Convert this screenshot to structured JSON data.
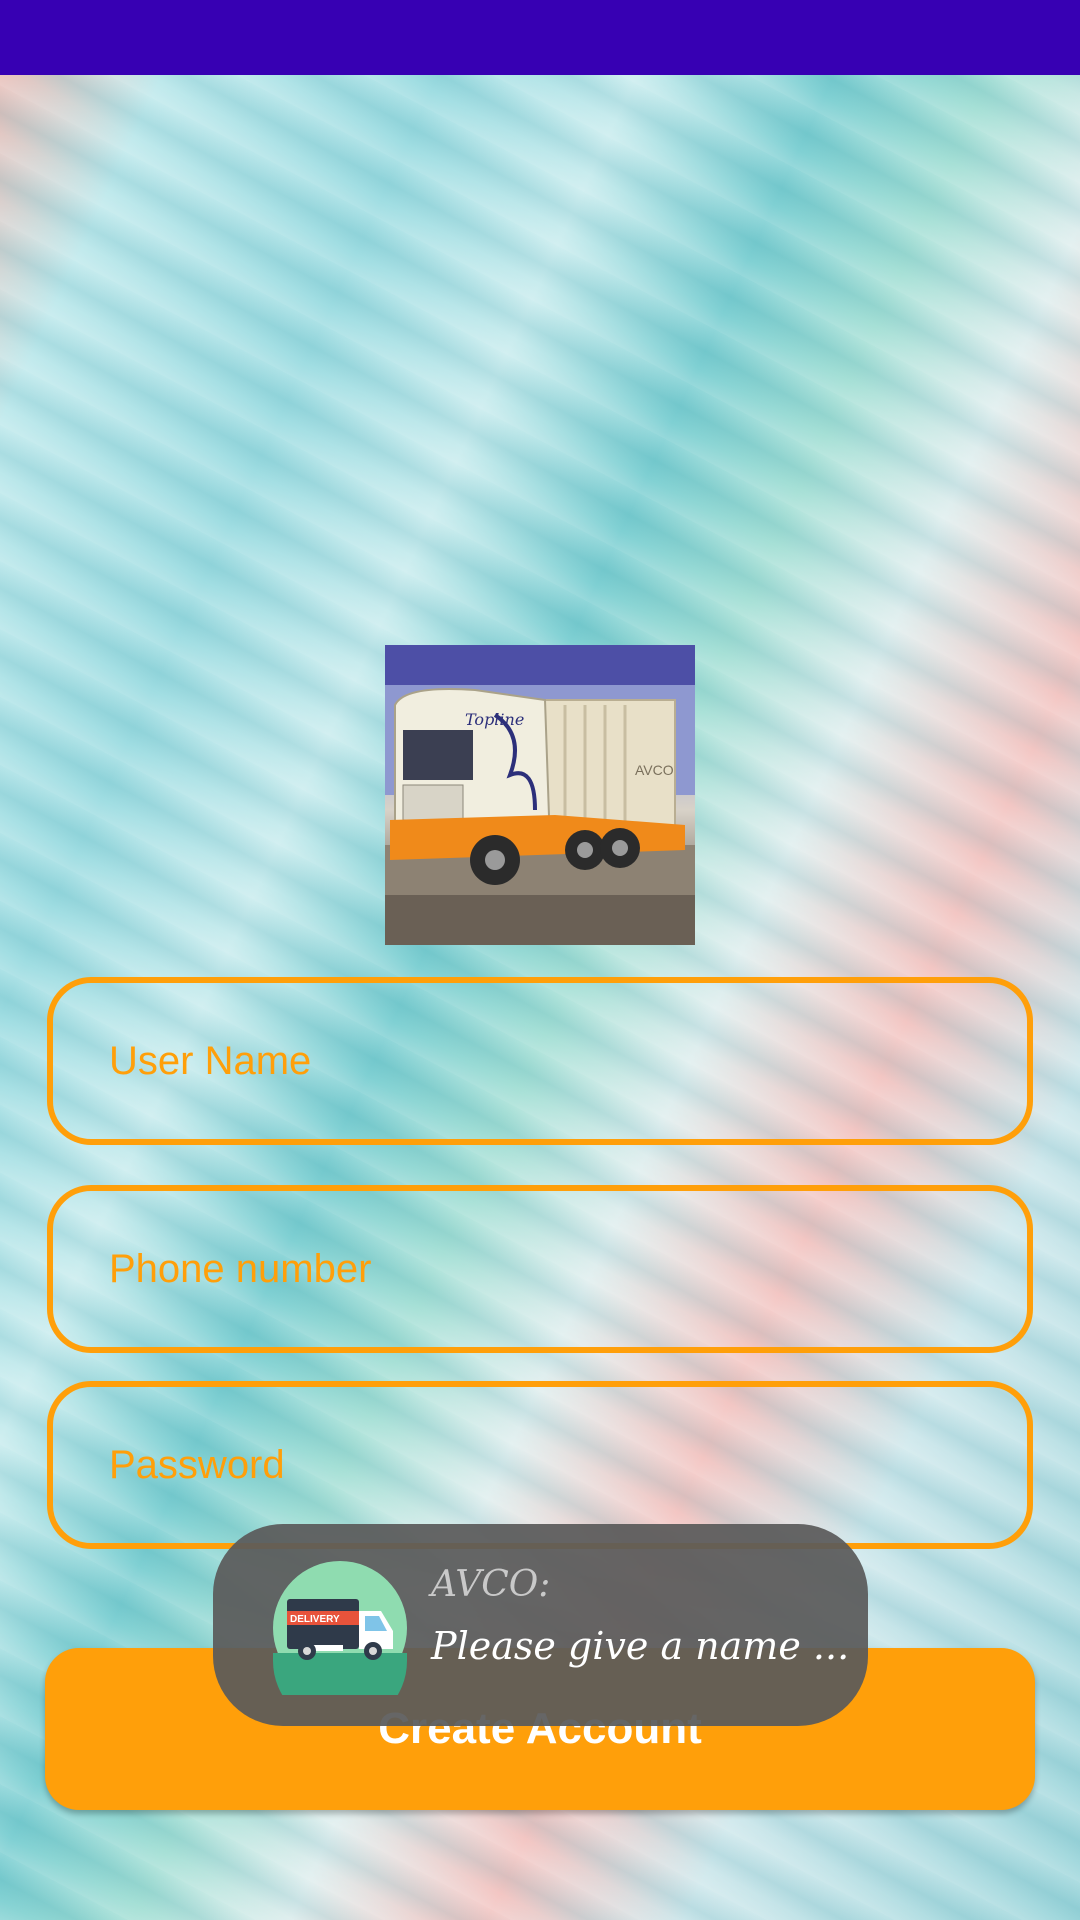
{
  "status_bar": {
    "color": "#3700b3"
  },
  "logo_image": {
    "description_icon": "truck-photo",
    "truck_cab_lettering": "Topline",
    "container_lettering": "AVCO"
  },
  "form": {
    "username_placeholder": "User Name",
    "phone_placeholder": "Phone number",
    "password_placeholder": "Password",
    "accent_color": "#ff9f0a"
  },
  "create_button": {
    "label": "Create Account"
  },
  "toast": {
    "icon": "delivery-truck-icon",
    "icon_badge_text": "DELIVERY",
    "title": "AVCO:",
    "message": "Please give a name ..."
  }
}
